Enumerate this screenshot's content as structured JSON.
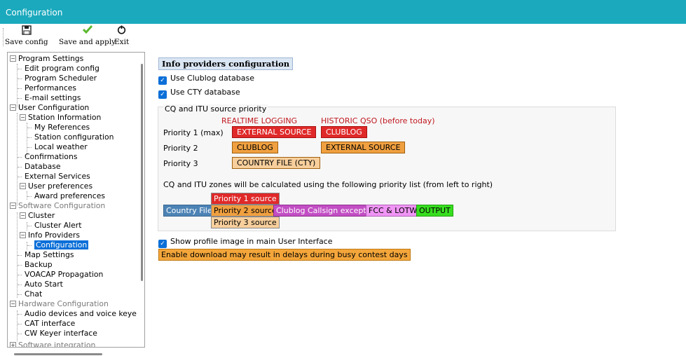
{
  "window": {
    "title": "Configuration"
  },
  "toolbar": {
    "save_config": {
      "label": "Save config",
      "icon": "floppy-disk-icon"
    },
    "save_apply": {
      "label": "Save and apply",
      "icon": "checkmark-icon"
    },
    "exit": {
      "label": "Exit",
      "icon": "power-icon"
    }
  },
  "tree": {
    "program_settings": "Program Settings",
    "edit_program_config": "Edit program config",
    "program_scheduler": "Program Scheduler",
    "performances": "Performances",
    "email_settings": "E-mail settings",
    "user_configuration": "User Configuration",
    "station_information": "Station Information",
    "my_references": "My References",
    "station_configuration": "Station configuration",
    "local_weather": "Local weather",
    "confirmations": "Confirmations",
    "database": "Database",
    "external_services": "External Services",
    "user_preferences": "User preferences",
    "award_preferences": "Award preferences",
    "software_configuration": "Software Configuration",
    "cluster": "Cluster",
    "cluster_alert": "Cluster Alert",
    "info_providers": "Info Providers",
    "configuration": "Configuration",
    "map_settings": "Map Settings",
    "backup": "Backup",
    "voacap": "VOACAP Propagation",
    "auto_start": "Auto Start",
    "chat": "Chat",
    "hardware_configuration": "Hardware Configuration",
    "audio_devices": "Audio devices and voice keye",
    "cat_interface": "CAT interface",
    "cw_keyer": "CW Keyer interface",
    "software_integration": "Software integration"
  },
  "content": {
    "section_title": "Info providers configuration",
    "use_clublog": {
      "label": "Use Clublog database",
      "checked": true
    },
    "use_cty": {
      "label": "Use CTY database",
      "checked": true
    },
    "group_title": "CQ and ITU source priority",
    "col_realtime": "REALTIME LOGGING",
    "col_historic": "HISTORIC QSO (before today)",
    "priorities": [
      {
        "label": "Priority 1 (max)",
        "realtime": "EXTERNAL SOURCE",
        "historic": "CLUBLOG"
      },
      {
        "label": "Priority 2",
        "realtime": "CLUBLOG",
        "historic": "EXTERNAL SOURCE"
      },
      {
        "label": "Priority 3",
        "realtime": "COUNTRY FILE (CTY)"
      }
    ],
    "zones_text": "CQ and ITU zones will be calculated using the following priority list (from left to right)",
    "chain": {
      "priority1": "Priority 1 source",
      "country_file": "Country File",
      "priority2": "Priority 2 source",
      "clublog_exception": "Clublog Callsign exception",
      "fcc_lotw": "FCC & LOTW",
      "output": "OUTPUT",
      "priority3": "Priority 3 source"
    },
    "show_profile_image": {
      "label": "Show profile image in main User Interface",
      "checked": true
    },
    "warning": "Enable download may result in delays during busy contest days"
  },
  "colors": {
    "titlebar": "#1ba9bd",
    "selection": "#0b6fd8",
    "red_tag": "#e02929",
    "orange_tag": "#f0a040",
    "peach_tag": "#f8cf9c",
    "country_file": "#4c83b5",
    "clublog_exception": "#c24ec4",
    "fcc_lotw": "#f095f5",
    "output": "#37de1f",
    "warning": "#f4a63a"
  }
}
